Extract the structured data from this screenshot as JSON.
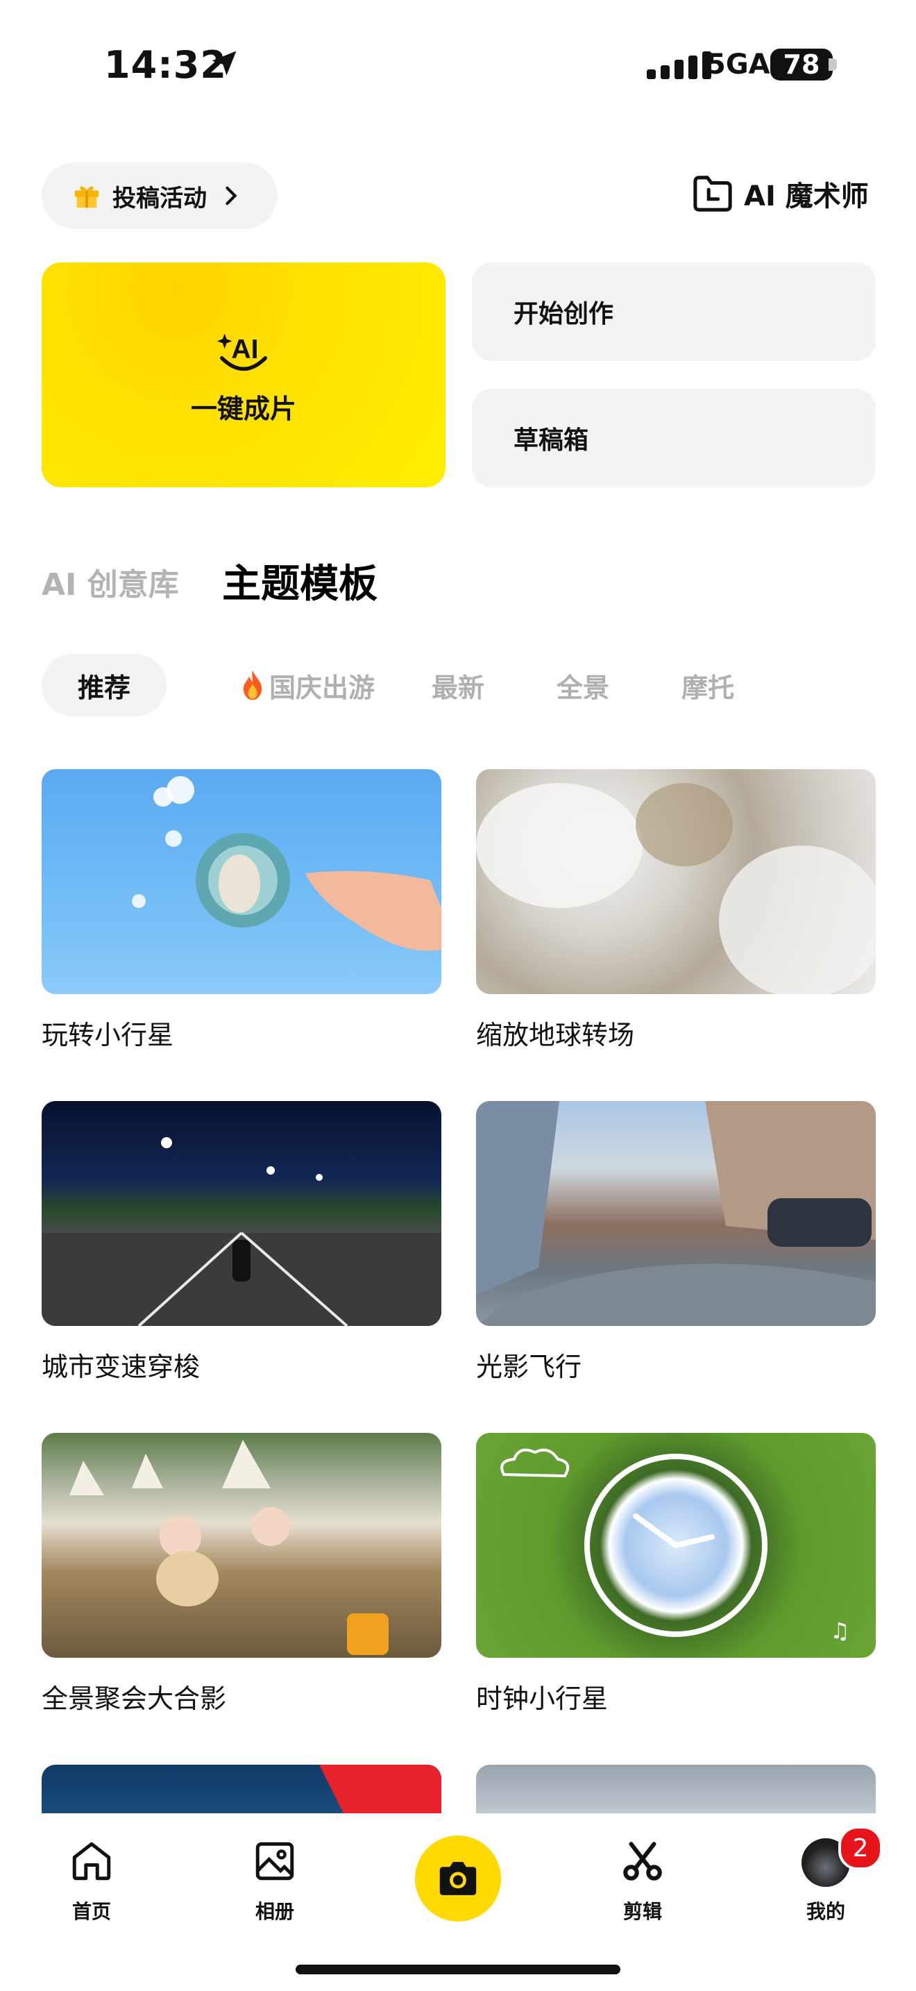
{
  "status_bar": {
    "time": "14:32",
    "network": "5GA",
    "battery": "78"
  },
  "header": {
    "submission_label": "投稿活动",
    "magician_label": "AI 魔术师"
  },
  "actions": {
    "one_click": "一键成片",
    "ai_badge": "AI",
    "start_create": "开始创作",
    "drafts": "草稿箱"
  },
  "section_tabs": [
    {
      "label": "AI 创意库",
      "active": false
    },
    {
      "label": "主题模板",
      "active": true
    }
  ],
  "chips": [
    {
      "label": "推荐",
      "active": true,
      "icon": ""
    },
    {
      "label": "国庆出游",
      "active": false,
      "icon": "fire-emoji"
    },
    {
      "label": "最新",
      "active": false,
      "icon": ""
    },
    {
      "label": "全景",
      "active": false,
      "icon": ""
    },
    {
      "label": "摩托",
      "active": false,
      "icon": ""
    }
  ],
  "templates": [
    {
      "title": "玩转小行星"
    },
    {
      "title": "缩放地球转场"
    },
    {
      "title": "城市变速穿梭"
    },
    {
      "title": "光影飞行"
    },
    {
      "title": "全景聚会大合影"
    },
    {
      "title": "时钟小行星"
    }
  ],
  "bottom_nav": {
    "items": [
      {
        "label": "首页",
        "icon": "home-icon"
      },
      {
        "label": "相册",
        "icon": "image-icon"
      },
      {
        "label": "",
        "icon": "camera-icon"
      },
      {
        "label": "剪辑",
        "icon": "scissors-icon"
      },
      {
        "label": "我的",
        "icon": "avatar"
      }
    ],
    "profile_badge": "2"
  },
  "colors": {
    "accent": "#FFE100",
    "chip_bg": "#F2F3F5",
    "badge": "#E8141B"
  }
}
